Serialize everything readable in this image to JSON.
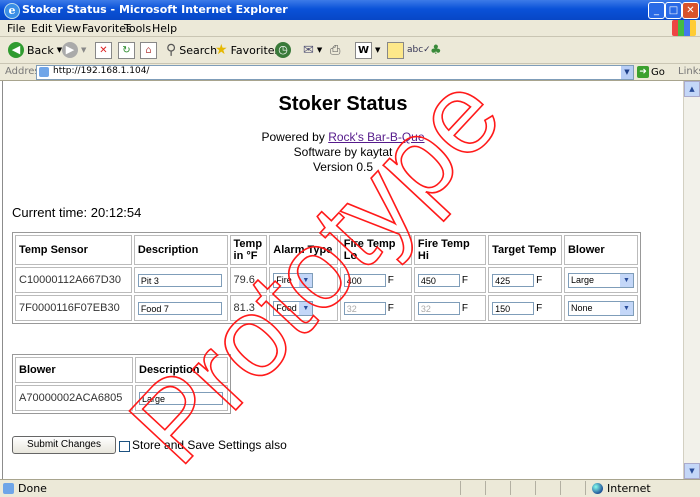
{
  "window": {
    "title": "Stoker Status - Microsoft Internet Explorer"
  },
  "menu": [
    "File",
    "Edit",
    "View",
    "Favorites",
    "Tools",
    "Help"
  ],
  "toolbar": {
    "back": "Back",
    "search": "Search",
    "favorites": "Favorites"
  },
  "address": {
    "label": "Address",
    "url": "http://192.168.1.104/",
    "go": "Go",
    "links": "Links"
  },
  "page": {
    "title": "Stoker Status",
    "powered_prefix": "Powered by",
    "powered_link": "Rock's Bar-B-Que",
    "software": "Software by kaytat",
    "version": "Version 0.5",
    "current_time_label": "Current time:",
    "current_time": "20:12:54",
    "sensor_table": {
      "headers": [
        "Temp Sensor",
        "Description",
        "Temp in °F",
        "Alarm Type",
        "Fire Temp Lo",
        "Fire Temp Hi",
        "Target Temp",
        "Blower"
      ],
      "rows": [
        {
          "id": "C10000112A667D30",
          "description": "Pit 3",
          "temp": "79.6",
          "alarm": "Fire",
          "lo": "400",
          "hi": "450",
          "target": "425",
          "blower": "Large"
        },
        {
          "id": "7F0000116F07EB30",
          "description": "Food 7",
          "temp": "81.3",
          "alarm": "Food",
          "lo": "32",
          "hi": "32",
          "target": "150",
          "blower": "None"
        }
      ],
      "unit": "F"
    },
    "blower_table": {
      "headers": [
        "Blower",
        "Description"
      ],
      "rows": [
        {
          "id": "A70000002ACA6805",
          "description": "Large"
        }
      ]
    },
    "submit_label": "Submit Changes",
    "store_label": "Store and Save Settings also",
    "watermark": "Prototype"
  },
  "status": {
    "left": "Done",
    "zone": "Internet"
  }
}
